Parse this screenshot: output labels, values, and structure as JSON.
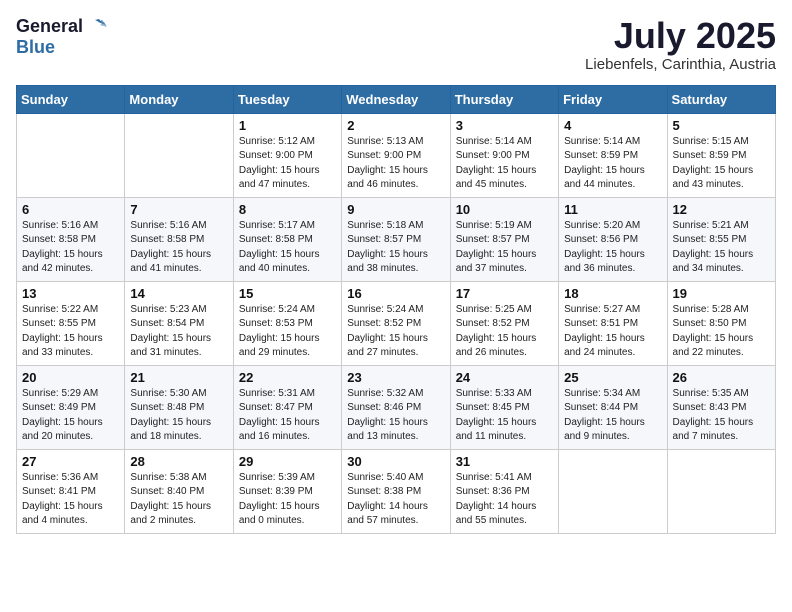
{
  "header": {
    "logo_text_general": "General",
    "logo_text_blue": "Blue",
    "month_year": "July 2025",
    "location": "Liebenfels, Carinthia, Austria"
  },
  "weekdays": [
    "Sunday",
    "Monday",
    "Tuesday",
    "Wednesday",
    "Thursday",
    "Friday",
    "Saturday"
  ],
  "weeks": [
    [
      {
        "day": "",
        "info": ""
      },
      {
        "day": "",
        "info": ""
      },
      {
        "day": "1",
        "info": "Sunrise: 5:12 AM\nSunset: 9:00 PM\nDaylight: 15 hours\nand 47 minutes."
      },
      {
        "day": "2",
        "info": "Sunrise: 5:13 AM\nSunset: 9:00 PM\nDaylight: 15 hours\nand 46 minutes."
      },
      {
        "day": "3",
        "info": "Sunrise: 5:14 AM\nSunset: 9:00 PM\nDaylight: 15 hours\nand 45 minutes."
      },
      {
        "day": "4",
        "info": "Sunrise: 5:14 AM\nSunset: 8:59 PM\nDaylight: 15 hours\nand 44 minutes."
      },
      {
        "day": "5",
        "info": "Sunrise: 5:15 AM\nSunset: 8:59 PM\nDaylight: 15 hours\nand 43 minutes."
      }
    ],
    [
      {
        "day": "6",
        "info": "Sunrise: 5:16 AM\nSunset: 8:58 PM\nDaylight: 15 hours\nand 42 minutes."
      },
      {
        "day": "7",
        "info": "Sunrise: 5:16 AM\nSunset: 8:58 PM\nDaylight: 15 hours\nand 41 minutes."
      },
      {
        "day": "8",
        "info": "Sunrise: 5:17 AM\nSunset: 8:58 PM\nDaylight: 15 hours\nand 40 minutes."
      },
      {
        "day": "9",
        "info": "Sunrise: 5:18 AM\nSunset: 8:57 PM\nDaylight: 15 hours\nand 38 minutes."
      },
      {
        "day": "10",
        "info": "Sunrise: 5:19 AM\nSunset: 8:57 PM\nDaylight: 15 hours\nand 37 minutes."
      },
      {
        "day": "11",
        "info": "Sunrise: 5:20 AM\nSunset: 8:56 PM\nDaylight: 15 hours\nand 36 minutes."
      },
      {
        "day": "12",
        "info": "Sunrise: 5:21 AM\nSunset: 8:55 PM\nDaylight: 15 hours\nand 34 minutes."
      }
    ],
    [
      {
        "day": "13",
        "info": "Sunrise: 5:22 AM\nSunset: 8:55 PM\nDaylight: 15 hours\nand 33 minutes."
      },
      {
        "day": "14",
        "info": "Sunrise: 5:23 AM\nSunset: 8:54 PM\nDaylight: 15 hours\nand 31 minutes."
      },
      {
        "day": "15",
        "info": "Sunrise: 5:24 AM\nSunset: 8:53 PM\nDaylight: 15 hours\nand 29 minutes."
      },
      {
        "day": "16",
        "info": "Sunrise: 5:24 AM\nSunset: 8:52 PM\nDaylight: 15 hours\nand 27 minutes."
      },
      {
        "day": "17",
        "info": "Sunrise: 5:25 AM\nSunset: 8:52 PM\nDaylight: 15 hours\nand 26 minutes."
      },
      {
        "day": "18",
        "info": "Sunrise: 5:27 AM\nSunset: 8:51 PM\nDaylight: 15 hours\nand 24 minutes."
      },
      {
        "day": "19",
        "info": "Sunrise: 5:28 AM\nSunset: 8:50 PM\nDaylight: 15 hours\nand 22 minutes."
      }
    ],
    [
      {
        "day": "20",
        "info": "Sunrise: 5:29 AM\nSunset: 8:49 PM\nDaylight: 15 hours\nand 20 minutes."
      },
      {
        "day": "21",
        "info": "Sunrise: 5:30 AM\nSunset: 8:48 PM\nDaylight: 15 hours\nand 18 minutes."
      },
      {
        "day": "22",
        "info": "Sunrise: 5:31 AM\nSunset: 8:47 PM\nDaylight: 15 hours\nand 16 minutes."
      },
      {
        "day": "23",
        "info": "Sunrise: 5:32 AM\nSunset: 8:46 PM\nDaylight: 15 hours\nand 13 minutes."
      },
      {
        "day": "24",
        "info": "Sunrise: 5:33 AM\nSunset: 8:45 PM\nDaylight: 15 hours\nand 11 minutes."
      },
      {
        "day": "25",
        "info": "Sunrise: 5:34 AM\nSunset: 8:44 PM\nDaylight: 15 hours\nand 9 minutes."
      },
      {
        "day": "26",
        "info": "Sunrise: 5:35 AM\nSunset: 8:43 PM\nDaylight: 15 hours\nand 7 minutes."
      }
    ],
    [
      {
        "day": "27",
        "info": "Sunrise: 5:36 AM\nSunset: 8:41 PM\nDaylight: 15 hours\nand 4 minutes."
      },
      {
        "day": "28",
        "info": "Sunrise: 5:38 AM\nSunset: 8:40 PM\nDaylight: 15 hours\nand 2 minutes."
      },
      {
        "day": "29",
        "info": "Sunrise: 5:39 AM\nSunset: 8:39 PM\nDaylight: 15 hours\nand 0 minutes."
      },
      {
        "day": "30",
        "info": "Sunrise: 5:40 AM\nSunset: 8:38 PM\nDaylight: 14 hours\nand 57 minutes."
      },
      {
        "day": "31",
        "info": "Sunrise: 5:41 AM\nSunset: 8:36 PM\nDaylight: 14 hours\nand 55 minutes."
      },
      {
        "day": "",
        "info": ""
      },
      {
        "day": "",
        "info": ""
      }
    ]
  ]
}
